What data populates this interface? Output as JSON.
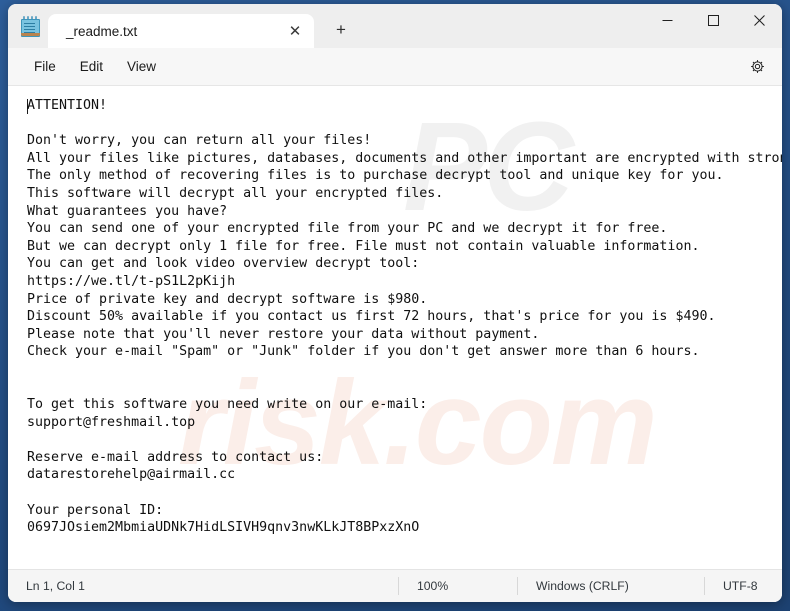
{
  "window": {
    "tab_label": "_readme.txt",
    "app_icon": "notepad-icon",
    "close_tab_glyph": "✕",
    "new_tab_glyph": "+",
    "minimize_label": "Minimize",
    "maximize_label": "Maximize",
    "close_label": "Close"
  },
  "menu": {
    "items": [
      {
        "label": "File"
      },
      {
        "label": "Edit"
      },
      {
        "label": "View"
      }
    ],
    "settings_icon": "gear-icon"
  },
  "document": {
    "text": "ATTENTION!\n\nDon't worry, you can return all your files!\nAll your files like pictures, databases, documents and other important are encrypted with strongest encryption and unique key.\nThe only method of recovering files is to purchase decrypt tool and unique key for you.\nThis software will decrypt all your encrypted files.\nWhat guarantees you have?\nYou can send one of your encrypted file from your PC and we decrypt it for free.\nBut we can decrypt only 1 file for free. File must not contain valuable information.\nYou can get and look video overview decrypt tool:\nhttps://we.tl/t-pS1L2pKijh\nPrice of private key and decrypt software is $980.\nDiscount 50% available if you contact us first 72 hours, that's price for you is $490.\nPlease note that you'll never restore your data without payment.\nCheck your e-mail \"Spam\" or \"Junk\" folder if you don't get answer more than 6 hours.\n\n\nTo get this software you need write on our e-mail:\nsupport@freshmail.top\n\nReserve e-mail address to contact us:\ndatarestorehelp@airmail.cc\n\nYour personal ID:\n0697JOsiem2MbmiaUDNk7HidLSIVH9qnv3nwKLkJT8BPxzXnO",
    "url": "https://we.tl/t-pS1L2pKijh",
    "price_full": "$980",
    "price_discount": "$490",
    "discount_percent": "50%",
    "discount_window_hours": "72",
    "answer_wait_hours": "6",
    "email_primary": "support@freshmail.top",
    "email_reserve": "datarestorehelp@airmail.cc",
    "personal_id": "0697JOsiem2MbmiaUDNk7HidLSIVH9qnv3nwKLkJT8BPxzXnO"
  },
  "watermark": {
    "grey_text": "PC",
    "pink_text": "risk.com"
  },
  "statusbar": {
    "line_col": "Ln 1, Col 1",
    "zoom": "100%",
    "line_ending": "Windows (CRLF)",
    "encoding": "UTF-8"
  },
  "colors": {
    "desktop": "#2a5894",
    "window_bg": "#f7f7f7",
    "editor_bg": "#ffffff",
    "text": "#101010",
    "watermark_grey": "#f1f1f1",
    "watermark_pink": "#fbeee9"
  }
}
